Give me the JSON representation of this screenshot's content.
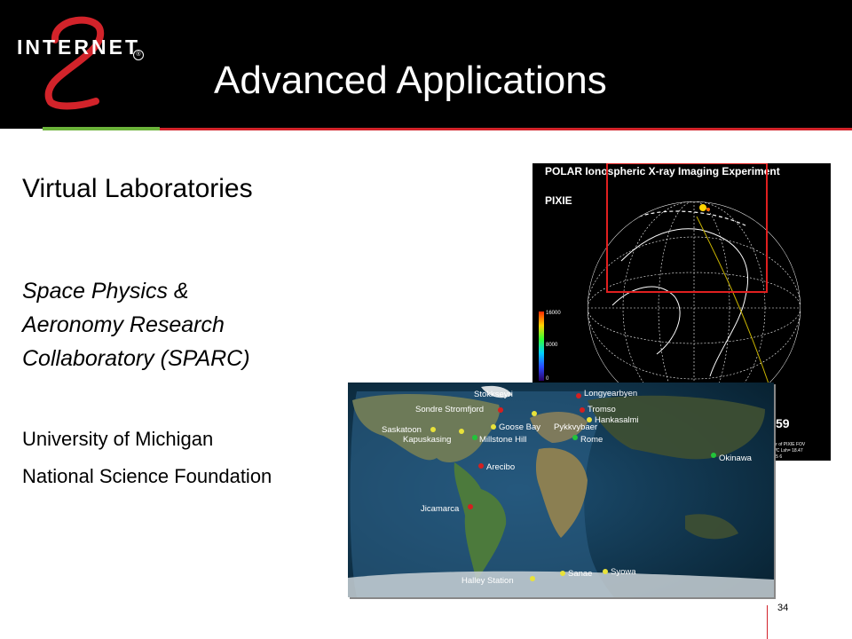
{
  "header": {
    "logo_text": "INTERNET",
    "logo_mark": "2",
    "logo_registered": "®",
    "title": "Advanced Applications"
  },
  "body": {
    "subtitle": "Virtual Laboratories",
    "project_lines": [
      "Space Physics &",
      "Aeronomy Research",
      "Collaboratory (SPARC)"
    ],
    "university": "University of Michigan",
    "foundation": "National Science Foundation"
  },
  "polar_figure": {
    "title": "POLAR Ionospheric X-ray Imaging Experiment",
    "instrument": "PIXIE",
    "scale_labels": [
      "16000",
      "8000",
      "0"
    ],
    "corner_number": "59",
    "footnote_lines": [
      "ter of PIXIE FOV",
      "S/C Lsh= 18.47",
      "4  5  6"
    ],
    "colors": {
      "box": "#e01f1f",
      "grid": "#ffffff",
      "track": "#c9b400"
    }
  },
  "world_map": {
    "sites": [
      {
        "name": "Stokkseyri",
        "color": "#d42020"
      },
      {
        "name": "Longyearbyen",
        "color": "#d42020"
      },
      {
        "name": "Sondre Stromfjord",
        "color": "#d42020"
      },
      {
        "name": "Tromso",
        "color": "#d42020"
      },
      {
        "name": "Hankasalmi",
        "color": "#e8e23a"
      },
      {
        "name": "Saskatoon",
        "color": "#e8e23a"
      },
      {
        "name": "Goose Bay",
        "color": "#e8e23a"
      },
      {
        "name": "Pykkvybaer",
        "color": "#e8e23a"
      },
      {
        "name": "Kapuskasing",
        "color": "#e8e23a"
      },
      {
        "name": "Millstone Hill",
        "color": "#22c43a"
      },
      {
        "name": "Rome",
        "color": "#22c43a"
      },
      {
        "name": "Okinawa",
        "color": "#22c43a"
      },
      {
        "name": "Arecibo",
        "color": "#d42020"
      },
      {
        "name": "Jicamarca",
        "color": "#d42020"
      },
      {
        "name": "Sanae",
        "color": "#e8e23a"
      },
      {
        "name": "Syowa",
        "color": "#e8e23a"
      },
      {
        "name": "Halley Station",
        "color": "#e8e23a"
      }
    ]
  },
  "footer": {
    "page_number": "34"
  }
}
